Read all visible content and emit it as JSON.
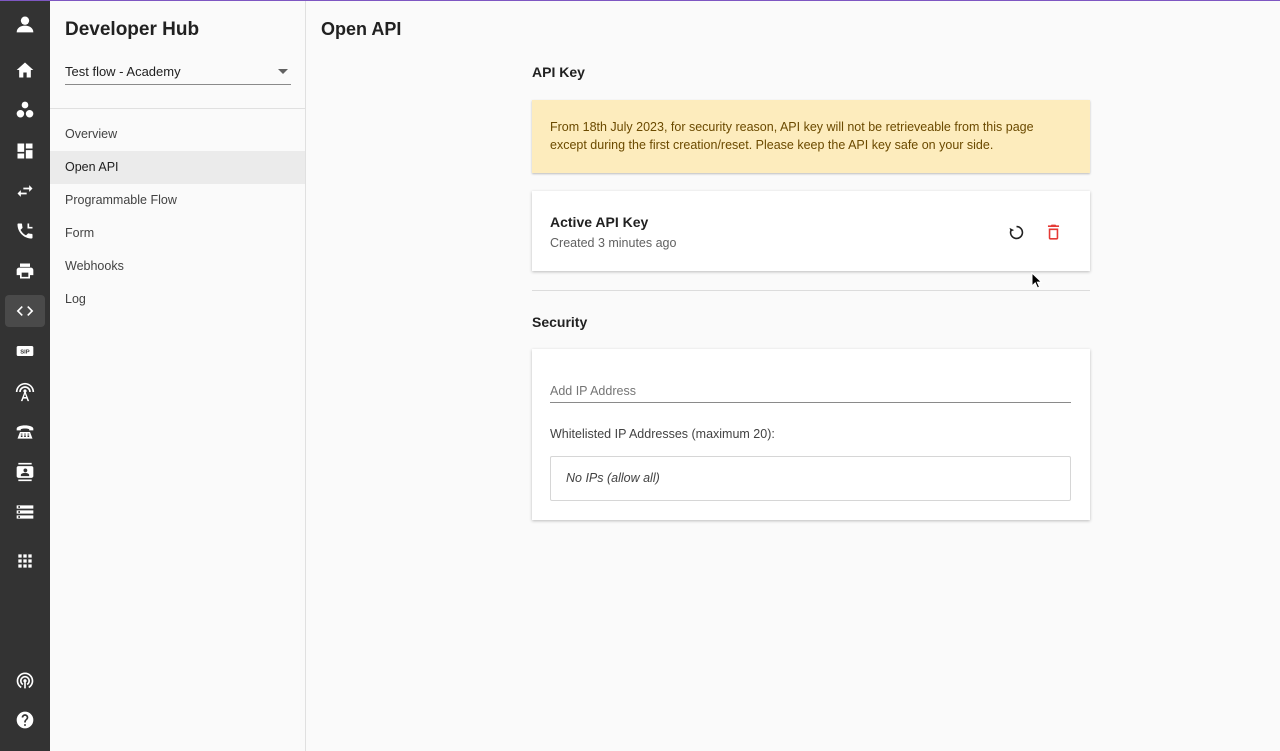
{
  "rail": {
    "items": [
      {
        "icon": "account-icon",
        "active": false
      },
      {
        "icon": "home-icon",
        "active": false
      },
      {
        "icon": "bubbles-icon",
        "active": false
      },
      {
        "icon": "dashboard-icon",
        "active": false
      },
      {
        "icon": "swap-icon",
        "active": false
      },
      {
        "icon": "phone-call-icon",
        "active": false
      },
      {
        "icon": "printer-icon",
        "active": false
      },
      {
        "icon": "code-icon",
        "active": true
      },
      {
        "icon": "sip-icon",
        "active": false
      },
      {
        "icon": "antenna-icon",
        "active": false
      },
      {
        "icon": "desk-phone-icon",
        "active": false
      },
      {
        "icon": "contact-card-icon",
        "active": false
      },
      {
        "icon": "storage-icon",
        "active": false
      },
      {
        "icon": "apps-grid-icon",
        "active": false
      },
      {
        "icon": "broadcast-icon",
        "active": false
      },
      {
        "icon": "help-icon",
        "active": false
      }
    ],
    "sip_text": "SIP"
  },
  "sidebar": {
    "title": "Developer Hub",
    "flow_select": "Test flow - Academy",
    "nav": [
      {
        "label": "Overview",
        "active": false
      },
      {
        "label": "Open API",
        "active": true
      },
      {
        "label": "Programmable Flow",
        "active": false
      },
      {
        "label": "Form",
        "active": false
      },
      {
        "label": "Webhooks",
        "active": false
      },
      {
        "label": "Log",
        "active": false
      }
    ]
  },
  "main": {
    "page_title": "Open API",
    "api_key_heading": "API Key",
    "warning_text": "From 18th July 2023, for security reason, API key will not be retrieveable from this page except during the first creation/reset. Please keep the API key safe on your side.",
    "key_card": {
      "title": "Active API Key",
      "subtitle": "Created 3 minutes ago"
    },
    "security_heading": "Security",
    "ip_input_placeholder": "Add IP Address",
    "whitelist_label": "Whitelisted IP Addresses (maximum 20):",
    "whitelist_empty": "No IPs (allow all)"
  },
  "colors": {
    "rail_bg": "#333333",
    "warning_bg": "#fdecbd",
    "delete_red": "#e53935",
    "top_accent": "#7e57c2"
  }
}
